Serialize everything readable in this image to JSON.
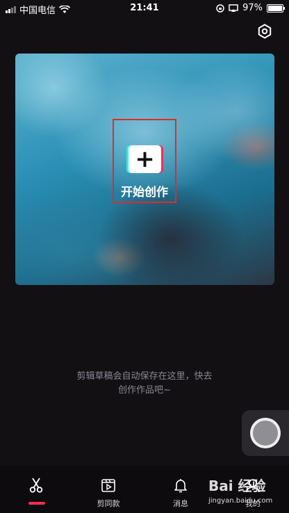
{
  "status_bar": {
    "carrier": "中国电信",
    "time": "21:41",
    "battery": "97%"
  },
  "icons": {
    "settings": "gear-icon",
    "wifi": "wifi-icon",
    "battery": "battery-icon",
    "create": "plus-icon"
  },
  "hero": {
    "create_label": "开始创作",
    "plus_symbol": "+"
  },
  "hint": {
    "line1": "剪辑草稿会自动保存在这里，快去",
    "line2": "创作作品吧~"
  },
  "tabbar": {
    "tabs": [
      {
        "label": "",
        "icon": "scissors-icon",
        "active": true
      },
      {
        "label": "剪同款",
        "icon": "template-play-icon",
        "active": false
      },
      {
        "label": "消息",
        "icon": "bell-icon",
        "active": false
      },
      {
        "label": "我的",
        "icon": "profile-icon",
        "active": false
      }
    ]
  },
  "watermark": {
    "main": "Bai 经验",
    "sub": "jingyan.baidu.com"
  },
  "colors": {
    "background": "#131014",
    "accent_red": "#fe2c55",
    "accent_cyan": "#25f4ee",
    "highlight_box": "#e02b2b"
  }
}
